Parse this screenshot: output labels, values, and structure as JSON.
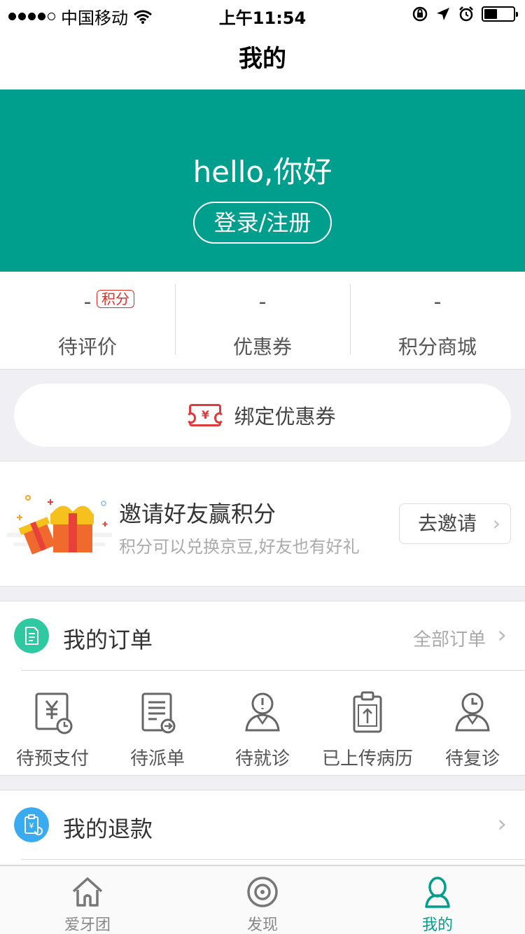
{
  "status_bar": {
    "carrier": "中国移动",
    "time": "上午11:54"
  },
  "nav": {
    "title": "我的"
  },
  "hero": {
    "greeting": "hello,你好",
    "login_label": "登录/注册",
    "bg_color": "#009f8d"
  },
  "stats": [
    {
      "value": "-",
      "label": "待评价",
      "badge": "积分"
    },
    {
      "value": "-",
      "label": "优惠券"
    },
    {
      "value": "-",
      "label": "积分商城"
    }
  ],
  "bind_coupon": {
    "label": "绑定优惠券",
    "icon_text": "¥"
  },
  "invite": {
    "title": "邀请好友赢积分",
    "subtitle": "积分可以兑换京豆,好友也有好礼",
    "button": "去邀请"
  },
  "orders": {
    "title": "我的订单",
    "all_label": "全部订单",
    "items": [
      {
        "label": "待预支付",
        "icon": "yen-clock-icon"
      },
      {
        "label": "待派单",
        "icon": "document-arrow-icon"
      },
      {
        "label": "待就诊",
        "icon": "person-alert-icon"
      },
      {
        "label": "已上传病历",
        "icon": "clipboard-upload-icon"
      },
      {
        "label": "待复诊",
        "icon": "person-clock-icon"
      }
    ]
  },
  "refunds": {
    "title": "我的退款"
  },
  "tabbar": {
    "active_color": "#009f8d",
    "tabs": [
      {
        "label": "爱牙团",
        "icon": "home-tooth-icon"
      },
      {
        "label": "发现",
        "icon": "discover-icon"
      },
      {
        "label": "我的",
        "icon": "person-icon",
        "active": true
      }
    ]
  }
}
